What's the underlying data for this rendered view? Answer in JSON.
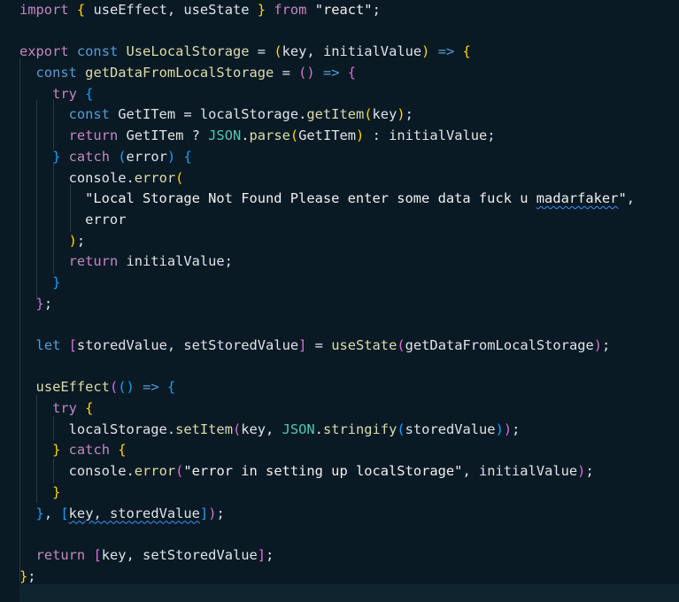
{
  "editor": {
    "lines": [
      [
        [
          "import",
          "kw-purple"
        ],
        [
          " ",
          "var"
        ],
        [
          "{",
          "b1"
        ],
        [
          " useEffect, useState ",
          "var"
        ],
        [
          "}",
          "b1"
        ],
        [
          " ",
          "var"
        ],
        [
          "from",
          "kw-purple"
        ],
        [
          " ",
          "var"
        ],
        [
          "\"react\"",
          "str-light"
        ],
        [
          ";",
          "var"
        ]
      ],
      [],
      [
        [
          "export",
          "kw-purple"
        ],
        [
          " ",
          "var"
        ],
        [
          "const",
          "kw-blue"
        ],
        [
          " ",
          "var"
        ],
        [
          "UseLocalStorage",
          "fn"
        ],
        [
          " = ",
          "var"
        ],
        [
          "(",
          "b1"
        ],
        [
          "key, initialValue",
          "var"
        ],
        [
          ")",
          "b1"
        ],
        [
          " ",
          "var"
        ],
        [
          "=>",
          "kw-blue"
        ],
        [
          " ",
          "var"
        ],
        [
          "{",
          "b1"
        ]
      ],
      [
        [
          "  ",
          "var"
        ],
        [
          "const",
          "kw-blue"
        ],
        [
          " ",
          "var"
        ],
        [
          "getDataFromLocalStorage",
          "fn"
        ],
        [
          " = ",
          "var"
        ],
        [
          "()",
          "b2"
        ],
        [
          " ",
          "var"
        ],
        [
          "=>",
          "kw-blue"
        ],
        [
          " ",
          "var"
        ],
        [
          "{",
          "b2"
        ]
      ],
      [
        [
          "    ",
          "var"
        ],
        [
          "try",
          "kw-purple"
        ],
        [
          " ",
          "var"
        ],
        [
          "{",
          "b3"
        ]
      ],
      [
        [
          "      ",
          "var"
        ],
        [
          "const",
          "kw-blue"
        ],
        [
          " GetITem = ",
          "var"
        ],
        [
          "localStorage",
          "var"
        ],
        [
          ".",
          "var"
        ],
        [
          "getItem",
          "fn"
        ],
        [
          "(",
          "b1"
        ],
        [
          "key",
          "var"
        ],
        [
          ")",
          "b1"
        ],
        [
          ";",
          "var"
        ]
      ],
      [
        [
          "      ",
          "var"
        ],
        [
          "return",
          "kw-purple"
        ],
        [
          " GetITem ? ",
          "var"
        ],
        [
          "JSON",
          "cls"
        ],
        [
          ".",
          "var"
        ],
        [
          "parse",
          "fn"
        ],
        [
          "(",
          "b1"
        ],
        [
          "GetITem",
          "var"
        ],
        [
          ")",
          "b1"
        ],
        [
          " : initialValue;",
          "var"
        ]
      ],
      [
        [
          "    ",
          "var"
        ],
        [
          "}",
          "b3"
        ],
        [
          " ",
          "var"
        ],
        [
          "catch",
          "kw-purple"
        ],
        [
          " ",
          "var"
        ],
        [
          "(",
          "b3"
        ],
        [
          "error",
          "var"
        ],
        [
          ")",
          "b3"
        ],
        [
          " ",
          "var"
        ],
        [
          "{",
          "b3"
        ]
      ],
      [
        [
          "      ",
          "var"
        ],
        [
          "console",
          "var"
        ],
        [
          ".",
          "var"
        ],
        [
          "error",
          "fn"
        ],
        [
          "(",
          "b1"
        ]
      ],
      [
        [
          "        ",
          "var"
        ],
        [
          "\"Local Storage Not Found Please enter some data fuck u ",
          "str-light"
        ],
        [
          "madarfaker",
          "str-light",
          "squiggle"
        ],
        [
          "\"",
          "str-light"
        ],
        [
          ",",
          "var"
        ]
      ],
      [
        [
          "        error",
          "var"
        ]
      ],
      [
        [
          "      ",
          "var"
        ],
        [
          ")",
          "b1"
        ],
        [
          ";",
          "var"
        ]
      ],
      [
        [
          "      ",
          "var"
        ],
        [
          "return",
          "kw-purple"
        ],
        [
          " initialValue;",
          "var"
        ]
      ],
      [
        [
          "    ",
          "var"
        ],
        [
          "}",
          "b3"
        ]
      ],
      [
        [
          "  ",
          "var"
        ],
        [
          "}",
          "b2"
        ],
        [
          ";",
          "var"
        ]
      ],
      [],
      [
        [
          "  ",
          "var"
        ],
        [
          "let",
          "kw-blue"
        ],
        [
          " ",
          "var"
        ],
        [
          "[",
          "b2"
        ],
        [
          "storedValue, setStoredValue",
          "var"
        ],
        [
          "]",
          "b2"
        ],
        [
          " = ",
          "var"
        ],
        [
          "useState",
          "fn"
        ],
        [
          "(",
          "b2"
        ],
        [
          "getDataFromLocalStorage",
          "var"
        ],
        [
          ")",
          "b2"
        ],
        [
          ";",
          "var"
        ]
      ],
      [],
      [
        [
          "  ",
          "var"
        ],
        [
          "useEffect",
          "fn"
        ],
        [
          "(",
          "b2"
        ],
        [
          "()",
          "b3"
        ],
        [
          " ",
          "var"
        ],
        [
          "=>",
          "kw-blue"
        ],
        [
          " ",
          "var"
        ],
        [
          "{",
          "b3"
        ]
      ],
      [
        [
          "    ",
          "var"
        ],
        [
          "try",
          "kw-purple"
        ],
        [
          " ",
          "var"
        ],
        [
          "{",
          "b1"
        ]
      ],
      [
        [
          "      ",
          "var"
        ],
        [
          "localStorage",
          "var"
        ],
        [
          ".",
          "var"
        ],
        [
          "setItem",
          "fn"
        ],
        [
          "(",
          "b2"
        ],
        [
          "key, ",
          "var"
        ],
        [
          "JSON",
          "cls"
        ],
        [
          ".",
          "var"
        ],
        [
          "stringify",
          "fn"
        ],
        [
          "(",
          "b3"
        ],
        [
          "storedValue",
          "var"
        ],
        [
          ")",
          "b3"
        ],
        [
          ")",
          "b2"
        ],
        [
          ";",
          "var"
        ]
      ],
      [
        [
          "    ",
          "var"
        ],
        [
          "}",
          "b1"
        ],
        [
          " ",
          "var"
        ],
        [
          "catch",
          "kw-purple"
        ],
        [
          " ",
          "var"
        ],
        [
          "{",
          "b1"
        ]
      ],
      [
        [
          "      ",
          "var"
        ],
        [
          "console",
          "var"
        ],
        [
          ".",
          "var"
        ],
        [
          "error",
          "fn"
        ],
        [
          "(",
          "b2"
        ],
        [
          "\"error in setting up localStorage\"",
          "str-light"
        ],
        [
          ", initialValue",
          "var"
        ],
        [
          ")",
          "b2"
        ],
        [
          ";",
          "var"
        ]
      ],
      [
        [
          "    ",
          "var"
        ],
        [
          "}",
          "b1"
        ]
      ],
      [
        [
          "  ",
          "var"
        ],
        [
          "}",
          "b3"
        ],
        [
          ", ",
          "var"
        ],
        [
          "[",
          "b3"
        ],
        [
          "key, storedValue",
          "var",
          "squiggle"
        ],
        [
          "]",
          "b3"
        ],
        [
          ")",
          "b2"
        ],
        [
          ";",
          "var"
        ]
      ],
      [],
      [
        [
          "  ",
          "var"
        ],
        [
          "return",
          "kw-purple"
        ],
        [
          " ",
          "var"
        ],
        [
          "[",
          "b2"
        ],
        [
          "key, setStoredValue",
          "var"
        ],
        [
          "]",
          "b2"
        ],
        [
          ";",
          "var"
        ]
      ],
      [
        [
          "}",
          "b1"
        ],
        [
          ";",
          "var"
        ]
      ]
    ],
    "colors": {
      "background": "#0a1a25",
      "keyword_blue": "#569cd6",
      "keyword_purple": "#c586c0",
      "function": "#dcdcaa",
      "bracket_gold": "#ffd700",
      "bracket_orchid": "#da70d6",
      "bracket_blue": "#179fff",
      "class": "#4ec9b0",
      "string": "#f0f0f0",
      "squiggle": "#3794ff"
    }
  }
}
